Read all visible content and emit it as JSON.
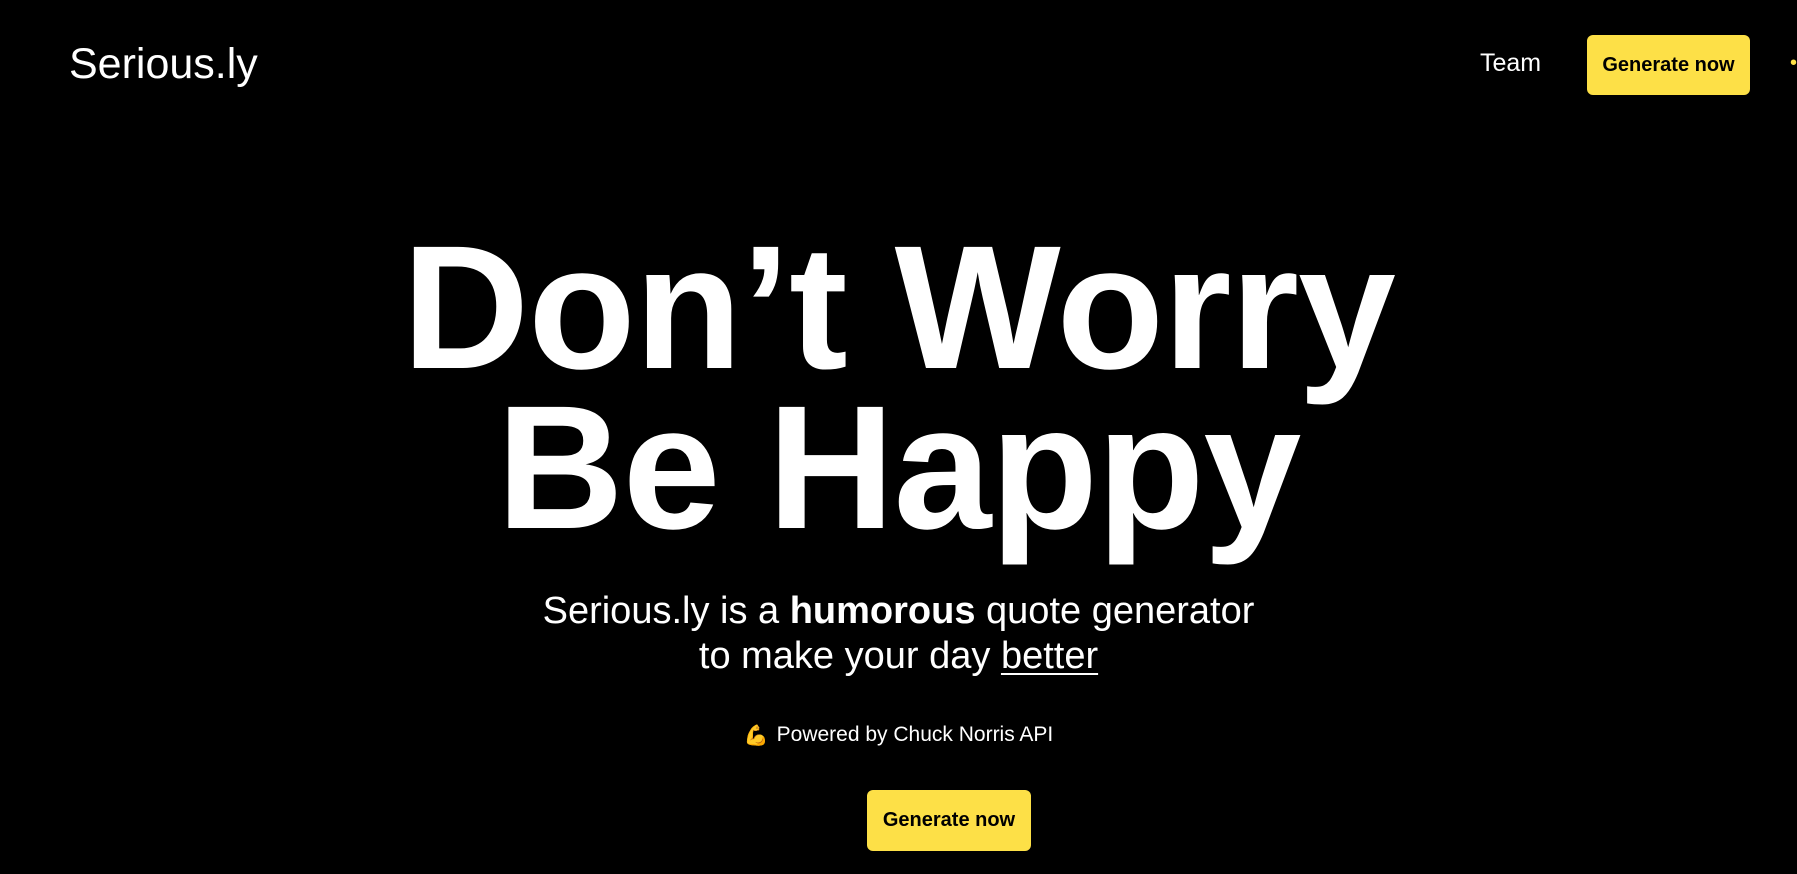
{
  "header": {
    "logo": "Serious.ly",
    "nav_team": "Team",
    "cta_label": "Generate now"
  },
  "hero": {
    "title_line1": "Don’t Worry",
    "title_line2": "Be Happy",
    "subtitle_part1": "Serious.ly is a ",
    "subtitle_bold": "humorous",
    "subtitle_part2": " quote generator",
    "subtitle_line2_part1": "to make your day ",
    "subtitle_underlined": "better",
    "powered_icon": "💪",
    "powered_text": "Powered by Chuck Norris API",
    "cta_label": "Generate now"
  },
  "colors": {
    "background": "#000000",
    "text": "#ffffff",
    "accent": "#fde047"
  },
  "icons": {
    "powered_icon_name": "flexed-biceps-icon"
  }
}
